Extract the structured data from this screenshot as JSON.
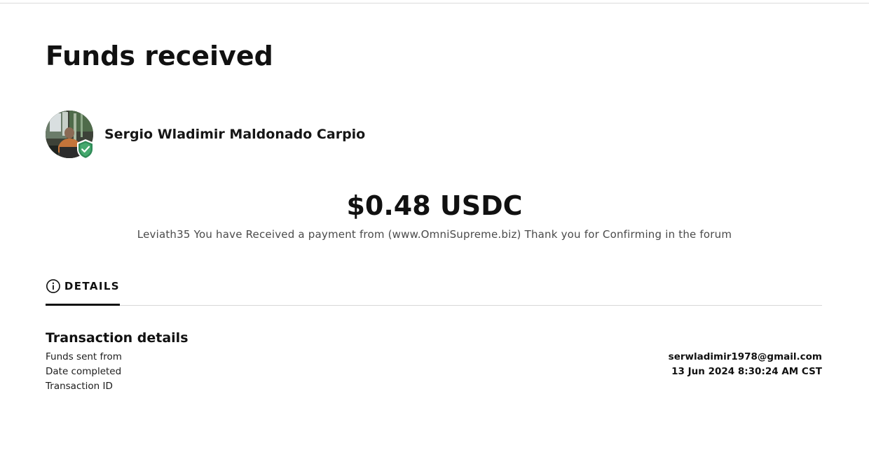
{
  "page": {
    "title": "Funds received"
  },
  "sender": {
    "name": "Sergio Wladimir Maldonado Carpio",
    "avatar_icon": "user-photo-avatar",
    "badge_icon": "verified-shield-icon",
    "badge_color": "#2f8a57"
  },
  "payment": {
    "amount": "$0.48 USDC",
    "note": "Leviath35 You have Received a payment from (www.OmniSupreme.biz) Thank you for Confirming in the forum"
  },
  "tabs": {
    "details_label": "DETAILS",
    "details_icon": "info-circle-icon"
  },
  "transaction": {
    "section_title": "Transaction details",
    "labels": {
      "funds_sent_from": "Funds sent from",
      "date_completed": "Date completed",
      "transaction_id": "Transaction ID"
    },
    "values": {
      "funds_sent_from": "serwladimir1978@gmail.com",
      "date_completed": "13 Jun 2024 8:30:24 AM CST"
    }
  }
}
